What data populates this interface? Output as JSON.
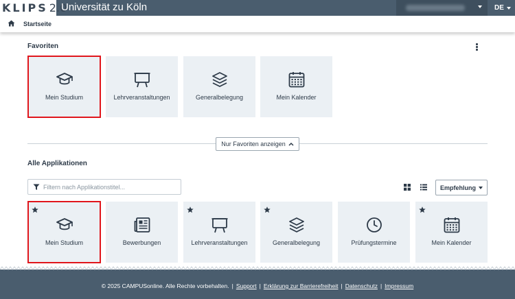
{
  "header": {
    "logo_text": "KLIPS",
    "logo_version": "2.0",
    "title": "Universität zu Köln",
    "language": "DE"
  },
  "breadcrumb": {
    "home_icon": "home-icon",
    "label": "Startseite"
  },
  "favorites": {
    "title": "Favoriten",
    "tiles": [
      {
        "label": "Mein Studium",
        "icon": "graduation-cap-icon"
      },
      {
        "label": "Lehrveranstaltungen",
        "icon": "presentation-board-icon"
      },
      {
        "label": "Generalbelegung",
        "icon": "layers-icon"
      },
      {
        "label": "Mein Kalender",
        "icon": "calendar-icon"
      }
    ]
  },
  "toggle_button": {
    "label": "Nur Favoriten anzeigen"
  },
  "all_apps": {
    "title": "Alle Applikationen",
    "filter_placeholder": "Filtern nach Applikationstitel...",
    "sort_label": "Empfehlung",
    "tiles": [
      {
        "label": "Mein Studium",
        "icon": "graduation-cap-icon",
        "starred": true
      },
      {
        "label": "Bewerbungen",
        "icon": "newspaper-icon",
        "starred": false
      },
      {
        "label": "Lehrveranstaltungen",
        "icon": "presentation-board-icon",
        "starred": true
      },
      {
        "label": "Generalbelegung",
        "icon": "layers-icon",
        "starred": true
      },
      {
        "label": "Prüfungstermine",
        "icon": "clock-icon",
        "starred": false
      },
      {
        "label": "Mein Kalender",
        "icon": "calendar-icon",
        "starred": true
      }
    ]
  },
  "footer": {
    "copyright": "© 2025 CAMPUSonline. Alle Rechte vorbehalten.",
    "separator": "|",
    "links": [
      "Support",
      "Erklärung zur Barrierefreiheit",
      "Datenschutz",
      "Impressum"
    ]
  },
  "colors": {
    "header_bg": "#4a5d6e",
    "tile_bg": "#ebf0f4",
    "selection_outline": "#e0151b",
    "text": "#2d3a48"
  }
}
